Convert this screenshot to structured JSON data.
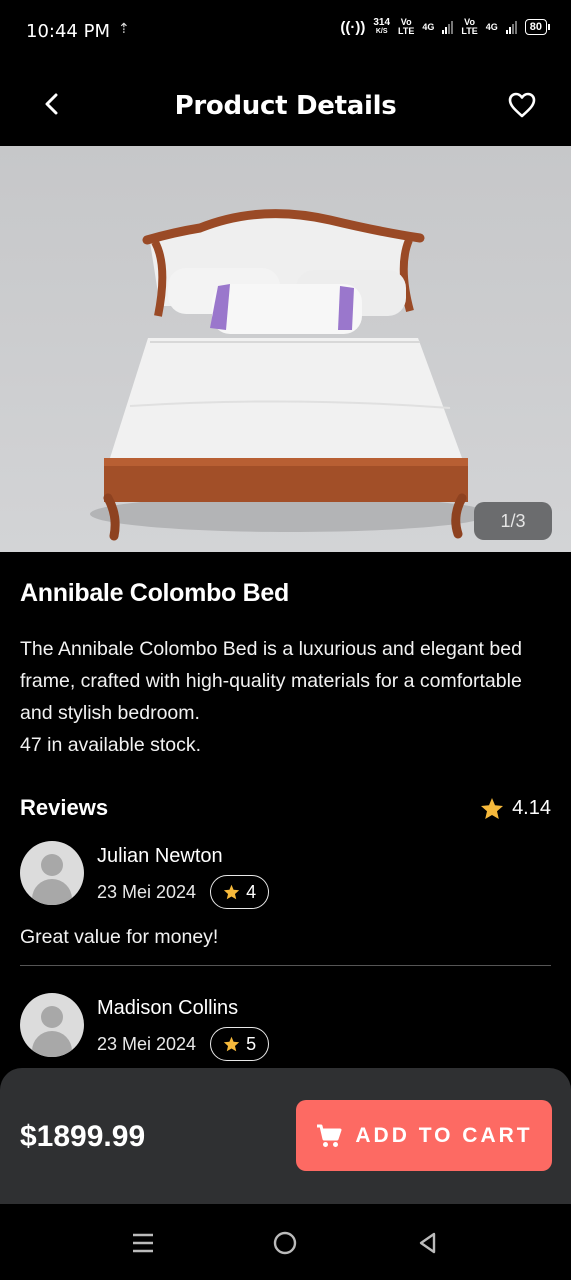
{
  "status_bar": {
    "time": "10:44 PM",
    "net_speed_value": "314",
    "net_speed_unit": "K/S",
    "sim1_top": "Vo",
    "sim1_bottom": "LTE",
    "net1": "4G",
    "sim2_top": "Vo",
    "sim2_bottom": "LTE",
    "net2": "4G",
    "battery": "80"
  },
  "header": {
    "title": "Product Details"
  },
  "image": {
    "counter": "1/3"
  },
  "product": {
    "name": "Annibale Colombo Bed",
    "description": "The Annibale Colombo Bed is a luxurious and elegant bed frame, crafted with high-quality materials for a comfortable and stylish bedroom.",
    "stock": "47 in available stock."
  },
  "reviews": {
    "title": "Reviews",
    "average": "4.14",
    "items": [
      {
        "name": "Julian Newton",
        "date": "23 Mei 2024",
        "rating": "4",
        "comment": "Great value for money!"
      },
      {
        "name": "Madison Collins",
        "date": "23 Mei 2024",
        "rating": "5"
      }
    ]
  },
  "cart": {
    "price": "$1899.99",
    "button_label": "ADD TO CART"
  },
  "colors": {
    "accent": "#fd6a63",
    "star": "#f6b93b",
    "cart_bar": "#2f3032"
  },
  "icons": [
    "back-arrow-icon",
    "heart-icon",
    "star-icon",
    "cart-icon",
    "menu-icon",
    "home-icon",
    "back-triangle-icon"
  ]
}
